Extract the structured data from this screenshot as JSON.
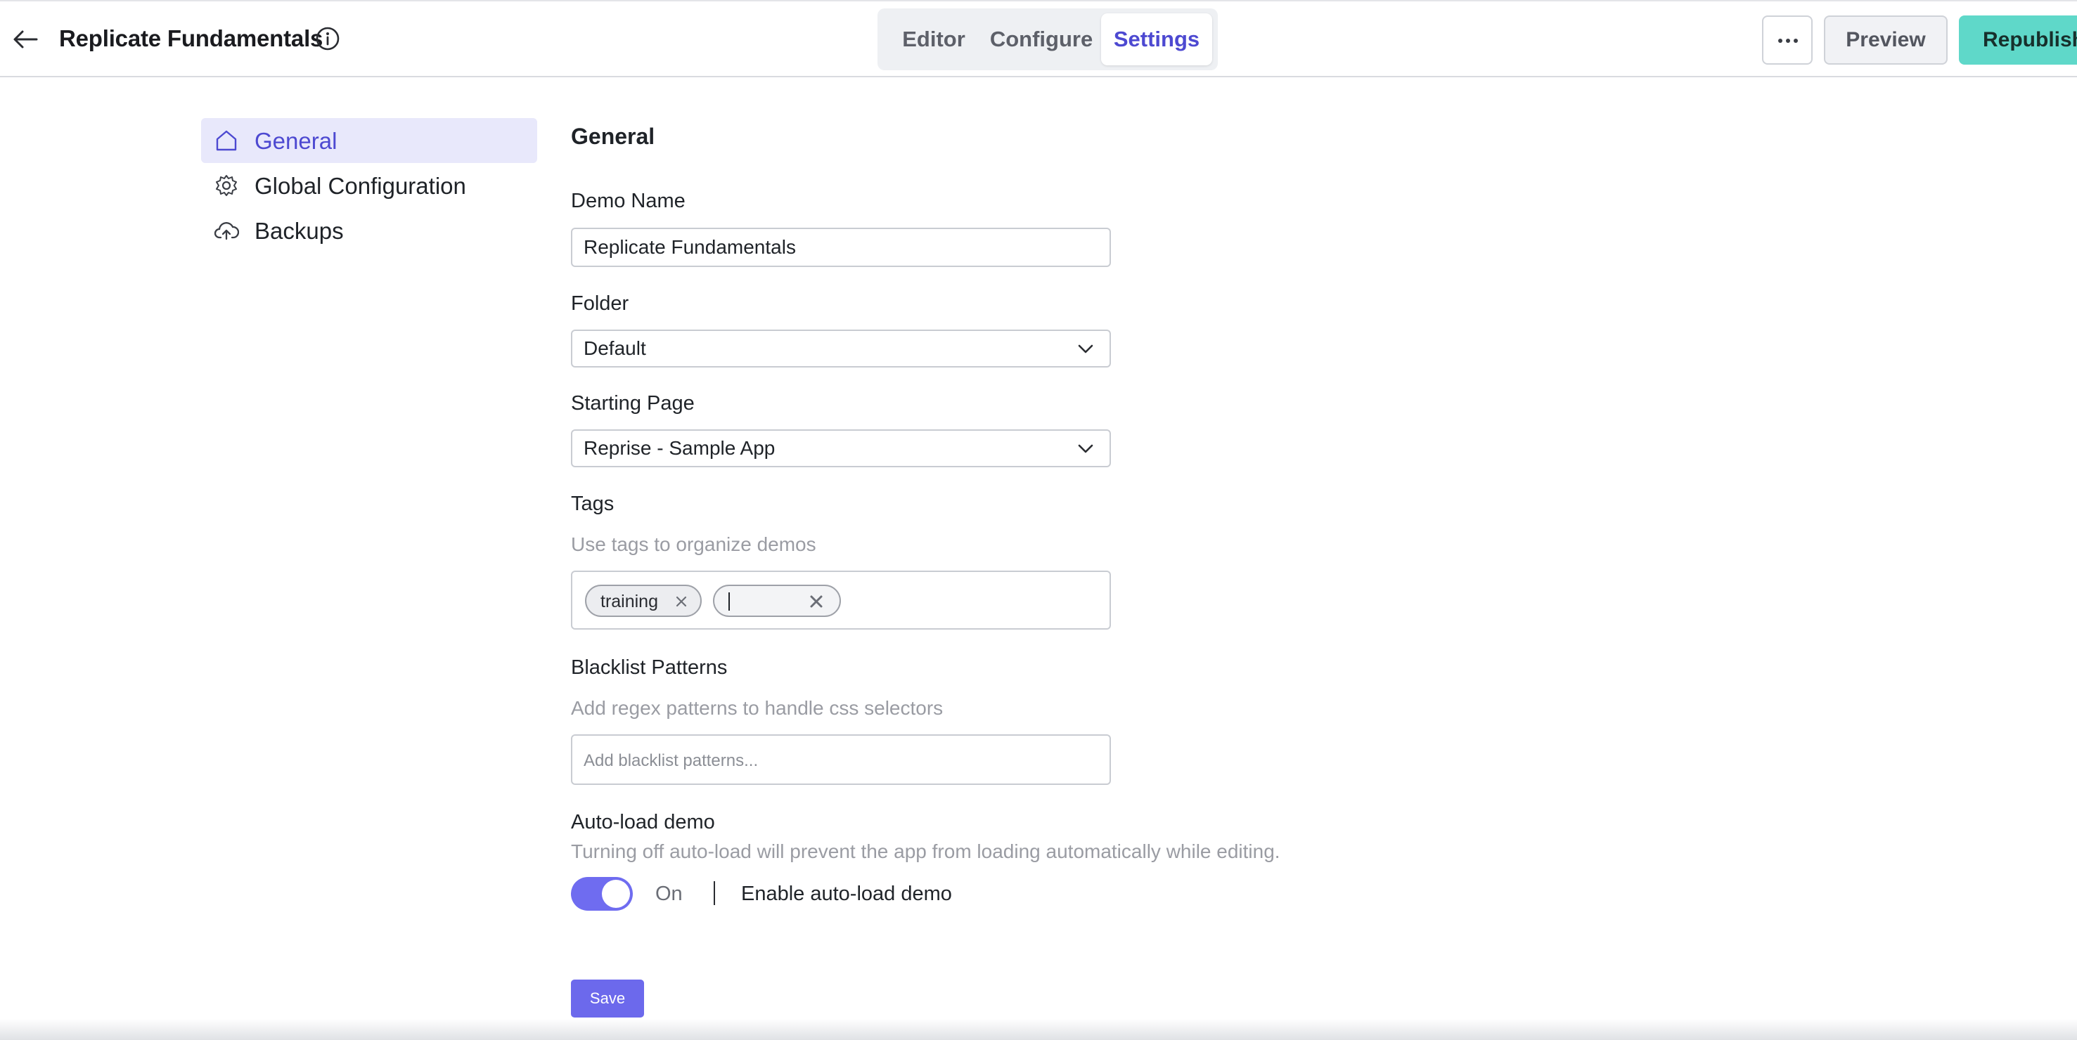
{
  "header": {
    "title": "Replicate Fundamentals",
    "back_icon": "arrow-left-icon",
    "info_icon": "info-circle-icon",
    "tabs": [
      {
        "label": "Editor",
        "active": false
      },
      {
        "label": "Configure",
        "active": false
      },
      {
        "label": "Settings",
        "active": true
      }
    ],
    "more_icon": "ellipsis-icon",
    "preview_label": "Preview",
    "republish_label": "Republish"
  },
  "sidebar": {
    "items": [
      {
        "label": "General",
        "icon": "home-icon",
        "active": true
      },
      {
        "label": "Global Configuration",
        "icon": "settings-gear-icon",
        "active": false
      },
      {
        "label": "Backups",
        "icon": "cloud-upload-icon",
        "active": false
      }
    ]
  },
  "form": {
    "section_title": "General",
    "demo_name": {
      "label": "Demo Name",
      "value": "Replicate Fundamentals"
    },
    "folder": {
      "label": "Folder",
      "value": "Default"
    },
    "starting_page": {
      "label": "Starting Page",
      "value": "Reprise - Sample App"
    },
    "tags": {
      "label": "Tags",
      "helper": "Use tags to organize demos",
      "items": [
        "training"
      ],
      "new_tag_value": ""
    },
    "blacklist": {
      "label": "Blacklist Patterns",
      "helper": "Add regex patterns to handle css selectors",
      "placeholder": "Add blacklist patterns..."
    },
    "autoload": {
      "label": "Auto-load demo",
      "helper": "Turning off auto-load will prevent the app from loading automatically while editing.",
      "state": "On",
      "enabled": true,
      "toggle_label": "Enable auto-load demo"
    },
    "save_label": "Save"
  },
  "colors": {
    "accent": "#4d49d1",
    "toggle_on": "#6f6cf0",
    "republish": "#5fd8c9",
    "active_nav_bg": "#e8e8fb"
  }
}
